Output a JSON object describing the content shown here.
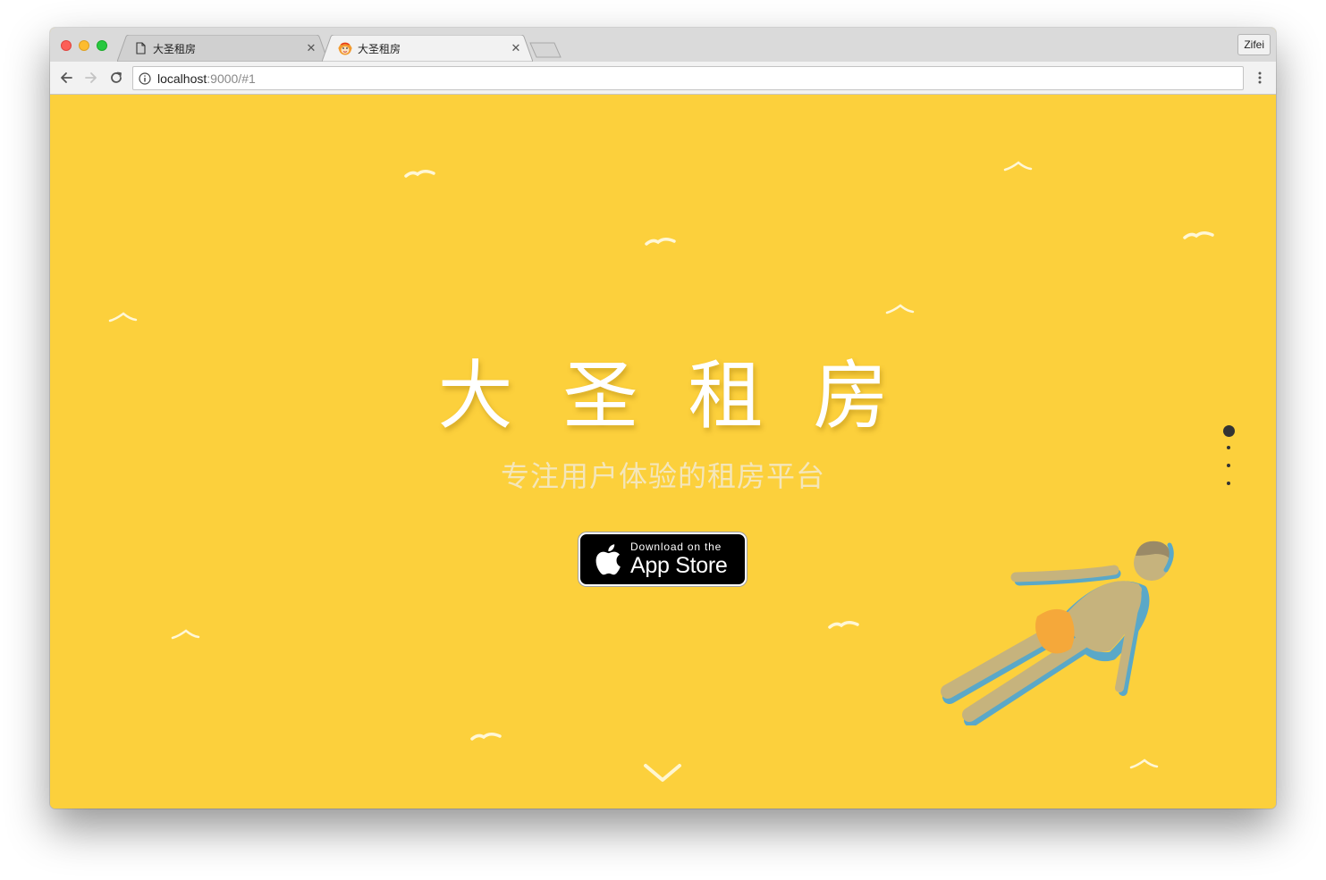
{
  "browser": {
    "tabs": [
      {
        "title": "大圣租房",
        "active": false,
        "favicon": "page-icon"
      },
      {
        "title": "大圣租房",
        "active": true,
        "favicon": "monkey-favicon-icon"
      }
    ],
    "close_glyph": "✕",
    "profile_label": "Zifei",
    "url": {
      "host": "localhost",
      "rest": ":9000/#1"
    }
  },
  "page": {
    "background_color": "#fcd03c",
    "title": "大圣租房",
    "subtitle": "专注用户体验的租房平台",
    "app_store": {
      "small_text": "Download on the",
      "big_text": "App Store"
    },
    "section_dots": {
      "count": 4,
      "active_index": 0
    }
  }
}
